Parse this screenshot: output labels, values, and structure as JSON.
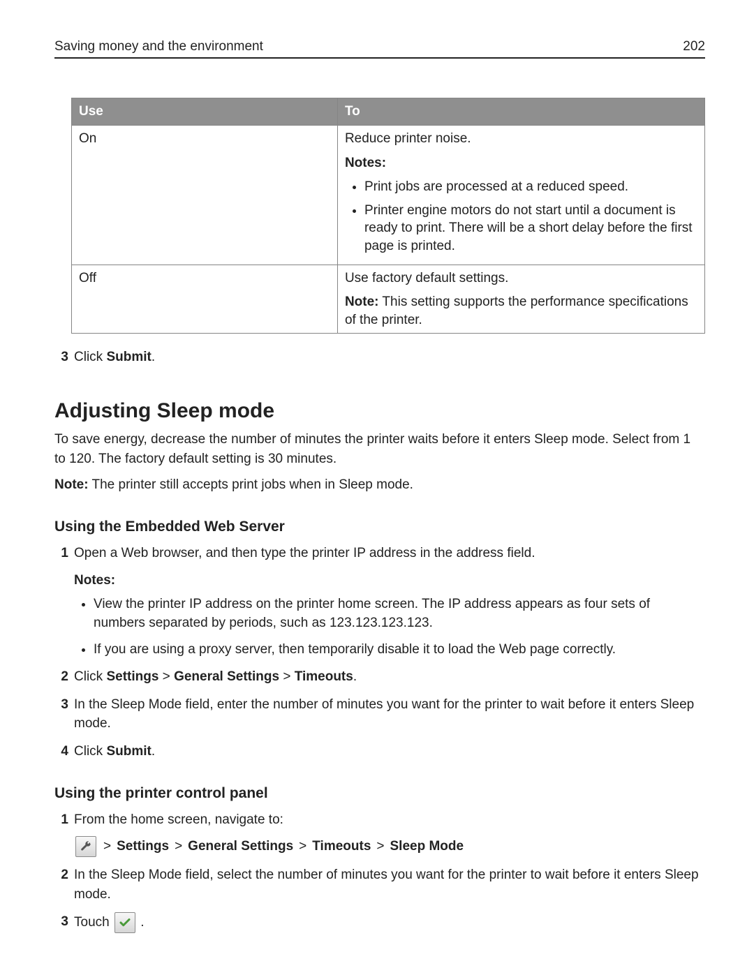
{
  "header": {
    "chapter": "Saving money and the environment",
    "page_number": "202"
  },
  "table": {
    "headers": {
      "use": "Use",
      "to": "To"
    },
    "rows": [
      {
        "use": "On",
        "to_line": "Reduce printer noise.",
        "notes_label": "Notes:",
        "bullets": [
          "Print jobs are processed at a reduced speed.",
          "Printer engine motors do not start until a document is ready to print. There will be a short delay before the first page is printed."
        ]
      },
      {
        "use": "Off",
        "to_line": "Use factory default settings.",
        "note_label": "Note:",
        "note_text": " This setting supports the performance specifications of the printer."
      }
    ]
  },
  "step3": {
    "prefix": "Click ",
    "bold": "Submit",
    "suffix": "."
  },
  "section": {
    "title": "Adjusting Sleep mode",
    "p1": "To save energy, decrease the number of minutes the printer waits before it enters Sleep mode. Select from 1 to 120. The factory default setting is 30 minutes.",
    "p2_label": "Note:",
    "p2_text": " The printer still accepts print jobs when in Sleep mode."
  },
  "ews": {
    "heading": "Using the Embedded Web Server",
    "step1": "Open a Web browser, and then type the printer IP address in the address field.",
    "notes_label": "Notes:",
    "bullets": [
      "View the printer IP address on the printer home screen. The IP address appears as four sets of numbers separated by periods, such as 123.123.123.123.",
      "If you are using a proxy server, then temporarily disable it to load the Web page correctly."
    ],
    "step2": {
      "prefix": "Click ",
      "b1": "Settings",
      "sep": " > ",
      "b2": "General Settings",
      "b3": "Timeouts",
      "suffix": "."
    },
    "step3": "In the Sleep Mode field, enter the number of minutes you want for the printer to wait before it enters Sleep mode.",
    "step4": {
      "prefix": "Click ",
      "bold": "Submit",
      "suffix": "."
    }
  },
  "panel": {
    "heading": "Using the printer control panel",
    "step1": "From the home screen, navigate to:",
    "breadcrumb": {
      "sep": " > ",
      "b1": "Settings",
      "b2": "General Settings",
      "b3": "Timeouts",
      "b4": "Sleep Mode"
    },
    "step2": "In the Sleep Mode field, select the number of minutes you want for the printer to wait before it enters Sleep mode.",
    "step3_prefix": "Touch ",
    "step3_suffix": "."
  }
}
